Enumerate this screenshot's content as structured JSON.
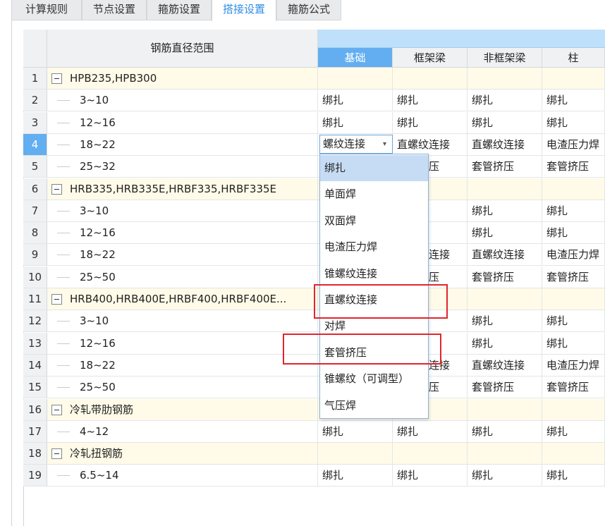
{
  "tabs": [
    "计算规则",
    "节点设置",
    "箍筋设置",
    "搭接设置",
    "箍筋公式"
  ],
  "active_tab": "搭接设置",
  "table": {
    "range_header": "钢筋直径范围",
    "columns": [
      "基础",
      "框架梁",
      "非框架梁",
      "柱"
    ],
    "rows": [
      {
        "num": "1",
        "label": "HPB235,HPB300",
        "group": true,
        "cells": [
          "",
          "",
          "",
          ""
        ]
      },
      {
        "num": "2",
        "label": "3~10",
        "group": false,
        "cells": [
          "绑扎",
          "绑扎",
          "绑扎",
          "绑扎"
        ]
      },
      {
        "num": "3",
        "label": "12~16",
        "group": false,
        "cells": [
          "绑扎",
          "绑扎",
          "绑扎",
          "绑扎"
        ]
      },
      {
        "num": "4",
        "label": "18~22",
        "group": false,
        "cells": [
          "",
          "直螺纹连接",
          "直螺纹连接",
          "电渣压力焊"
        ]
      },
      {
        "num": "5",
        "label": "25~32",
        "group": false,
        "cells": [
          "",
          "套管挤压",
          "套管挤压",
          "套管挤压"
        ]
      },
      {
        "num": "6",
        "label": "HRB335,HRB335E,HRBF335,HRBF335E",
        "group": true,
        "cells": [
          "",
          "",
          "",
          ""
        ]
      },
      {
        "num": "7",
        "label": "3~10",
        "group": false,
        "cells": [
          "",
          "",
          "绑扎",
          "绑扎"
        ]
      },
      {
        "num": "8",
        "label": "12~16",
        "group": false,
        "cells": [
          "",
          "",
          "绑扎",
          "绑扎"
        ]
      },
      {
        "num": "9",
        "label": "18~22",
        "group": false,
        "cells": [
          "",
          "直螺纹连接",
          "直螺纹连接",
          "电渣压力焊"
        ]
      },
      {
        "num": "10",
        "label": "25~50",
        "group": false,
        "cells": [
          "",
          "套管挤压",
          "套管挤压",
          "套管挤压"
        ]
      },
      {
        "num": "11",
        "label": "HRB400,HRB400E,HRBF400,HRBF400E...",
        "group": true,
        "cells": [
          "",
          "",
          "",
          ""
        ]
      },
      {
        "num": "12",
        "label": "3~10",
        "group": false,
        "cells": [
          "",
          "",
          "绑扎",
          "绑扎"
        ]
      },
      {
        "num": "13",
        "label": "12~16",
        "group": false,
        "cells": [
          "",
          "",
          "绑扎",
          "绑扎"
        ]
      },
      {
        "num": "14",
        "label": "18~22",
        "group": false,
        "cells": [
          "",
          "直螺纹连接",
          "直螺纹连接",
          "电渣压力焊"
        ]
      },
      {
        "num": "15",
        "label": "25~50",
        "group": false,
        "cells": [
          "",
          "套管挤压",
          "套管挤压",
          "套管挤压"
        ]
      },
      {
        "num": "16",
        "label": "冷轧带肋钢筋",
        "group": true,
        "cells": [
          "",
          "",
          "",
          ""
        ]
      },
      {
        "num": "17",
        "label": "4~12",
        "group": false,
        "cells": [
          "绑扎",
          "绑扎",
          "绑扎",
          "绑扎"
        ]
      },
      {
        "num": "18",
        "label": "冷轧扭钢筋",
        "group": true,
        "cells": [
          "",
          "",
          "",
          ""
        ]
      },
      {
        "num": "19",
        "label": "6.5~14",
        "group": false,
        "cells": [
          "绑扎",
          "绑扎",
          "绑扎",
          "绑扎"
        ]
      }
    ]
  },
  "editor": {
    "value": "螺纹连接",
    "caret": "▾"
  },
  "dropdown": {
    "options": [
      "绑扎",
      "单面焊",
      "双面焊",
      "电渣压力焊",
      "锥螺纹连接",
      "直螺纹连接",
      "对焊",
      "套管挤压",
      "锥螺纹（可调型）",
      "气压焊"
    ],
    "highlighted": "绑扎"
  },
  "highlight_color": "#e0262c"
}
